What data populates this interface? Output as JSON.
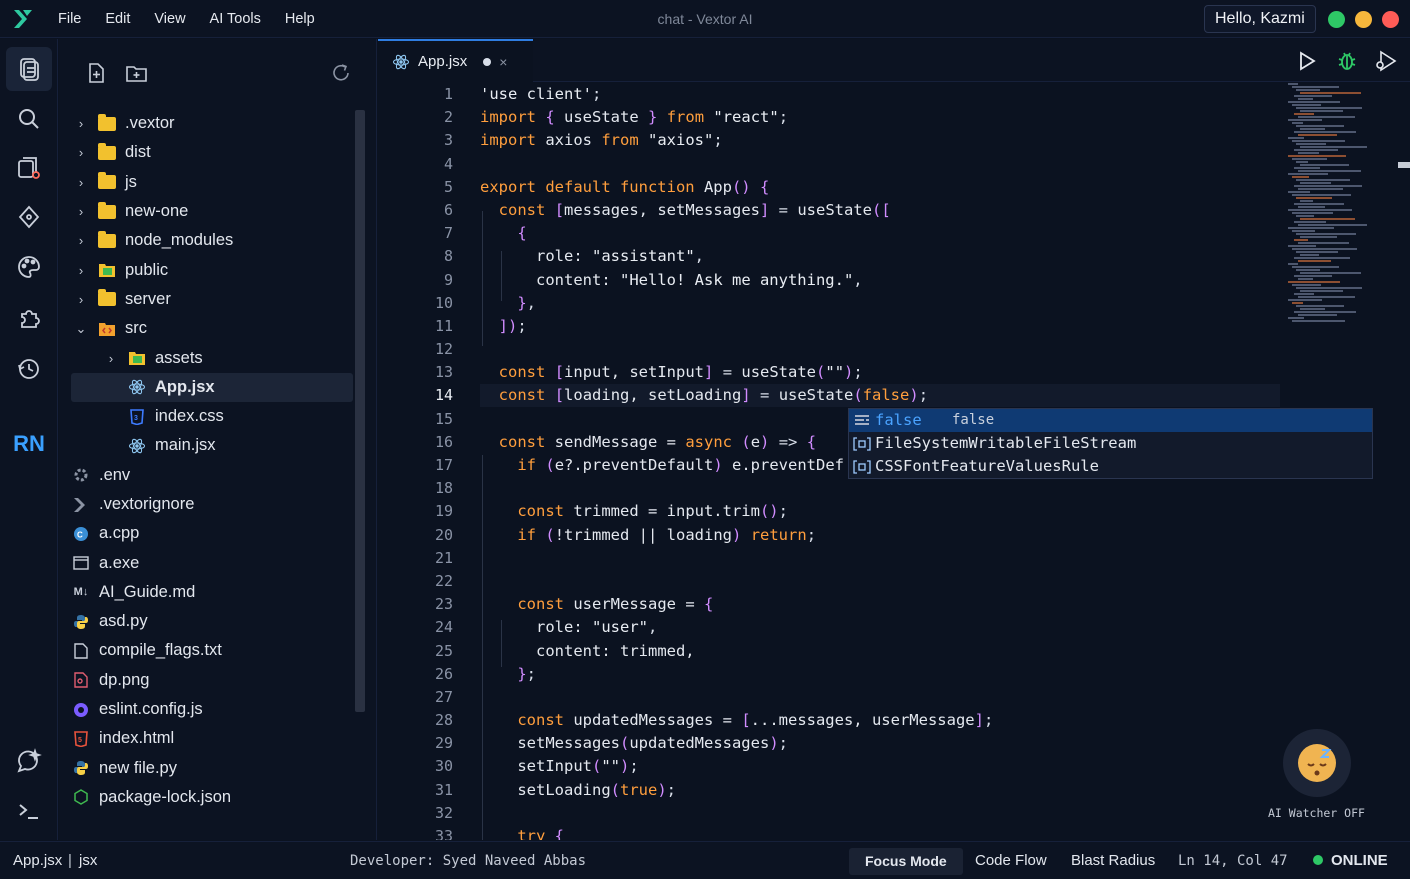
{
  "menu": [
    "File",
    "Edit",
    "View",
    "AI Tools",
    "Help"
  ],
  "window_title": "chat - Vextor AI",
  "greeting": "Hello, Kazmi",
  "activity": {
    "rn_label": "RN"
  },
  "explorer": {
    "items": [
      {
        "name": ".vextor",
        "type": "folder",
        "depth": 0,
        "expanded": false
      },
      {
        "name": "dist",
        "type": "folder",
        "depth": 0,
        "expanded": false
      },
      {
        "name": "js",
        "type": "folder",
        "depth": 0,
        "expanded": false
      },
      {
        "name": "new-one",
        "type": "folder",
        "depth": 0,
        "expanded": false
      },
      {
        "name": "node_modules",
        "type": "folder",
        "depth": 0,
        "expanded": false
      },
      {
        "name": "public",
        "type": "folder-img",
        "depth": 0,
        "expanded": false
      },
      {
        "name": "server",
        "type": "folder",
        "depth": 0,
        "expanded": false
      },
      {
        "name": "src",
        "type": "folder-src",
        "depth": 0,
        "expanded": true
      },
      {
        "name": "assets",
        "type": "folder-img",
        "depth": 1,
        "expanded": false
      },
      {
        "name": "App.jsx",
        "type": "react",
        "depth": 1,
        "selected": true
      },
      {
        "name": "index.css",
        "type": "css",
        "depth": 1
      },
      {
        "name": "main.jsx",
        "type": "react",
        "depth": 1
      },
      {
        "name": ".env",
        "type": "gear",
        "depth": 0
      },
      {
        "name": ".vextorignore",
        "type": "vextor",
        "depth": 0
      },
      {
        "name": "a.cpp",
        "type": "cpp",
        "depth": 0
      },
      {
        "name": "a.exe",
        "type": "exe",
        "depth": 0
      },
      {
        "name": "AI_Guide.md",
        "type": "md",
        "depth": 0
      },
      {
        "name": "asd.py",
        "type": "py",
        "depth": 0
      },
      {
        "name": "compile_flags.txt",
        "type": "txt",
        "depth": 0
      },
      {
        "name": "dp.png",
        "type": "png",
        "depth": 0
      },
      {
        "name": "eslint.config.js",
        "type": "eslint",
        "depth": 0
      },
      {
        "name": "index.html",
        "type": "html",
        "depth": 0
      },
      {
        "name": "new file.py",
        "type": "py",
        "depth": 0
      },
      {
        "name": "package-lock.json",
        "type": "node",
        "depth": 0
      }
    ]
  },
  "tab": {
    "label": "App.jsx",
    "close": "×"
  },
  "editor": {
    "current_line": 14,
    "lines": [
      [
        [
          "s",
          "'use client'"
        ],
        [
          "p",
          ";"
        ]
      ],
      [
        [
          "k",
          "import"
        ],
        [
          "p",
          " "
        ],
        [
          "b",
          "{"
        ],
        [
          "v",
          " useState "
        ],
        [
          "b",
          "}"
        ],
        [
          "p",
          " "
        ],
        [
          "k",
          "from"
        ],
        [
          "p",
          " "
        ],
        [
          "s",
          "\"react\""
        ],
        [
          "p",
          ";"
        ]
      ],
      [
        [
          "k",
          "import"
        ],
        [
          "v",
          " axios "
        ],
        [
          "k",
          "from"
        ],
        [
          "p",
          " "
        ],
        [
          "s",
          "\"axios\""
        ],
        [
          "p",
          ";"
        ]
      ],
      [],
      [
        [
          "k",
          "export default function"
        ],
        [
          "v",
          " App"
        ],
        [
          "b",
          "()"
        ],
        [
          "p",
          " "
        ],
        [
          "b",
          "{"
        ]
      ],
      [
        [
          "p",
          "  "
        ],
        [
          "k",
          "const"
        ],
        [
          "p",
          " "
        ],
        [
          "b",
          "["
        ],
        [
          "v",
          "messages, setMessages"
        ],
        [
          "b",
          "]"
        ],
        [
          "p",
          " = "
        ],
        [
          "v",
          "useState"
        ],
        [
          "b",
          "(["
        ]
      ],
      [
        [
          "p",
          "    "
        ],
        [
          "b",
          "{"
        ]
      ],
      [
        [
          "p",
          "      "
        ],
        [
          "v",
          "role: "
        ],
        [
          "s",
          "\"assistant\""
        ],
        [
          "p",
          ","
        ]
      ],
      [
        [
          "p",
          "      "
        ],
        [
          "v",
          "content: "
        ],
        [
          "s",
          "\"Hello! Ask me anything.\""
        ],
        [
          "p",
          ","
        ]
      ],
      [
        [
          "p",
          "    "
        ],
        [
          "b",
          "}"
        ],
        [
          "p",
          ","
        ]
      ],
      [
        [
          "p",
          "  "
        ],
        [
          "b",
          "])"
        ],
        [
          "p",
          ";"
        ]
      ],
      [],
      [
        [
          "p",
          "  "
        ],
        [
          "k",
          "const"
        ],
        [
          "p",
          " "
        ],
        [
          "b",
          "["
        ],
        [
          "v",
          "input, setInput"
        ],
        [
          "b",
          "]"
        ],
        [
          "p",
          " = "
        ],
        [
          "v",
          "useState"
        ],
        [
          "b",
          "("
        ],
        [
          "s",
          "\"\""
        ],
        [
          "b",
          ")"
        ],
        [
          "p",
          ";"
        ]
      ],
      [
        [
          "p",
          "  "
        ],
        [
          "k",
          "const"
        ],
        [
          "p",
          " "
        ],
        [
          "b",
          "["
        ],
        [
          "v",
          "loading, setLoading"
        ],
        [
          "b",
          "]"
        ],
        [
          "p",
          " = "
        ],
        [
          "v",
          "useState"
        ],
        [
          "b",
          "("
        ],
        [
          "t",
          "false"
        ],
        [
          "b",
          ")"
        ],
        [
          "p",
          ";"
        ]
      ],
      [],
      [
        [
          "p",
          "  "
        ],
        [
          "k",
          "const"
        ],
        [
          "v",
          " sendMessage = "
        ],
        [
          "k",
          "async"
        ],
        [
          "p",
          " "
        ],
        [
          "b",
          "("
        ],
        [
          "v",
          "e"
        ],
        [
          "b",
          ")"
        ],
        [
          "p",
          " => "
        ],
        [
          "b",
          "{"
        ]
      ],
      [
        [
          "p",
          "    "
        ],
        [
          "k",
          "if"
        ],
        [
          "p",
          " "
        ],
        [
          "b",
          "("
        ],
        [
          "v",
          "e?.preventDefault"
        ],
        [
          "b",
          ")"
        ],
        [
          "v",
          " e.preventDef"
        ]
      ],
      [],
      [
        [
          "p",
          "    "
        ],
        [
          "k",
          "const"
        ],
        [
          "v",
          " trimmed = input.trim"
        ],
        [
          "b",
          "()"
        ],
        [
          "p",
          ";"
        ]
      ],
      [
        [
          "p",
          "    "
        ],
        [
          "k",
          "if"
        ],
        [
          "p",
          " "
        ],
        [
          "b",
          "("
        ],
        [
          "v",
          "!trimmed || loading"
        ],
        [
          "b",
          ")"
        ],
        [
          "p",
          " "
        ],
        [
          "k",
          "return"
        ],
        [
          "p",
          ";"
        ]
      ],
      [],
      [],
      [
        [
          "p",
          "    "
        ],
        [
          "k",
          "const"
        ],
        [
          "v",
          " userMessage = "
        ],
        [
          "b",
          "{"
        ]
      ],
      [
        [
          "p",
          "      "
        ],
        [
          "v",
          "role: "
        ],
        [
          "s",
          "\"user\""
        ],
        [
          "p",
          ","
        ]
      ],
      [
        [
          "p",
          "      "
        ],
        [
          "v",
          "content: trimmed,"
        ]
      ],
      [
        [
          "p",
          "    "
        ],
        [
          "b",
          "}"
        ],
        [
          "p",
          ";"
        ]
      ],
      [],
      [
        [
          "p",
          "    "
        ],
        [
          "k",
          "const"
        ],
        [
          "v",
          " updatedMessages = "
        ],
        [
          "b",
          "["
        ],
        [
          "v",
          "...messages, userMessage"
        ],
        [
          "b",
          "]"
        ],
        [
          "p",
          ";"
        ]
      ],
      [
        [
          "p",
          "    "
        ],
        [
          "v",
          "setMessages"
        ],
        [
          "b",
          "("
        ],
        [
          "v",
          "updatedMessages"
        ],
        [
          "b",
          ")"
        ],
        [
          "p",
          ";"
        ]
      ],
      [
        [
          "p",
          "    "
        ],
        [
          "v",
          "setInput"
        ],
        [
          "b",
          "("
        ],
        [
          "s",
          "\"\""
        ],
        [
          "b",
          ")"
        ],
        [
          "p",
          ";"
        ]
      ],
      [
        [
          "p",
          "    "
        ],
        [
          "v",
          "setLoading"
        ],
        [
          "b",
          "("
        ],
        [
          "t",
          "true"
        ],
        [
          "b",
          ")"
        ],
        [
          "p",
          ";"
        ]
      ],
      [],
      [
        [
          "p",
          "    "
        ],
        [
          "k",
          "try"
        ],
        [
          "p",
          " "
        ],
        [
          "b",
          "{"
        ]
      ]
    ]
  },
  "suggestions": [
    {
      "label": "false",
      "detail": "false",
      "icon": "keyword"
    },
    {
      "label": "FileSystemWritableFileStream",
      "detail": "",
      "icon": "variable"
    },
    {
      "label": "CSSFontFeatureValuesRule",
      "detail": "",
      "icon": "variable"
    }
  ],
  "ai_watcher": "AI Watcher OFF",
  "status": {
    "file": "App.jsx",
    "lang": "jsx",
    "developer": "Developer: Syed Naveed Abbas",
    "focus": "Focus Mode",
    "codeflow": "Code Flow",
    "blast": "Blast Radius",
    "position": "Ln 14, Col 47",
    "online": "ONLINE"
  },
  "colors": {
    "accent": "#2f7de1",
    "keyword": "#ff9e3d",
    "bracket": "#d18cff",
    "online": "#2ec866"
  }
}
